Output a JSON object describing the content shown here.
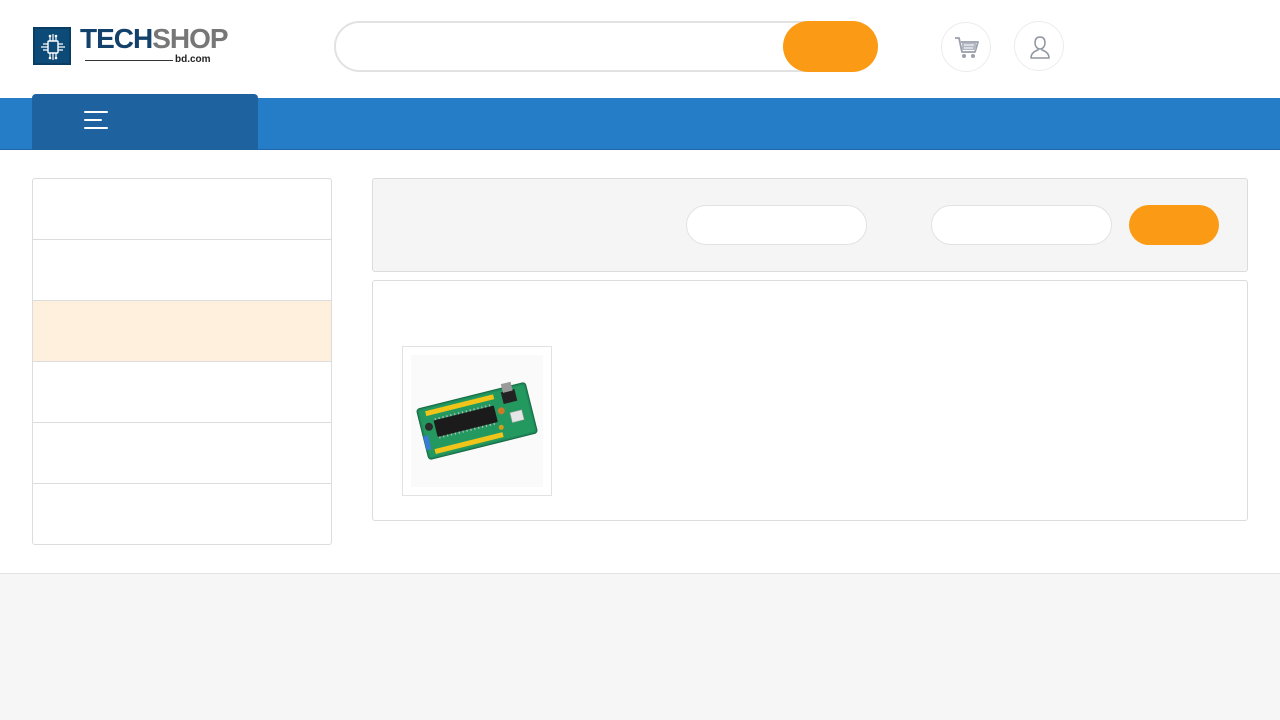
{
  "logo": {
    "brand_part1": "TECH",
    "brand_part2": "SHOP",
    "domain": "bd.com"
  },
  "header": {
    "search": {
      "value": "",
      "placeholder": "",
      "button_label": ""
    },
    "cart_icon": "cart-icon",
    "account_icon": "user-icon"
  },
  "navbar": {
    "menu_icon": "hamburger-menu-icon",
    "accent": "#257cc7",
    "toggle_bg": "#1e62a0"
  },
  "sidebar": {
    "items": [
      {
        "label": ""
      },
      {
        "label": ""
      },
      {
        "label": "",
        "active": true
      },
      {
        "label": ""
      },
      {
        "label": ""
      },
      {
        "label": ""
      }
    ],
    "active_bg": "#fff0de"
  },
  "filter": {
    "min_price": {
      "value": "",
      "placeholder": ""
    },
    "max_price": {
      "value": "",
      "placeholder": ""
    },
    "button_label": ""
  },
  "products": {
    "items": [
      {
        "image": "microcontroller-board-image"
      }
    ]
  },
  "colors": {
    "accent_orange": "#fb9a15",
    "nav_blue": "#257cc7",
    "footer_bg": "#f6f6f6"
  }
}
